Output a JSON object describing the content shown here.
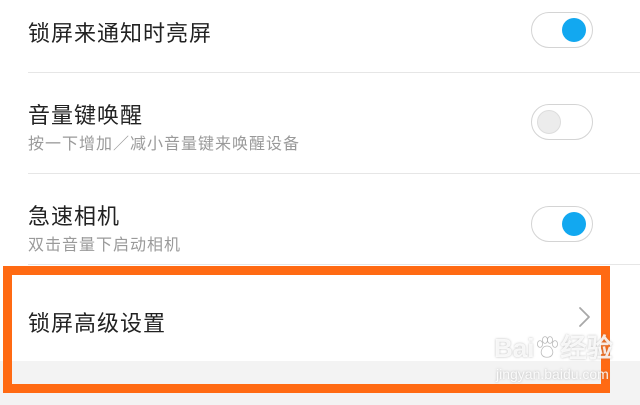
{
  "settings": {
    "items": [
      {
        "title": "锁屏来通知时亮屏",
        "subtitle": "",
        "toggle": "on"
      },
      {
        "title": "音量键唤醒",
        "subtitle": "按一下增加／减小音量键来唤醒设备",
        "toggle": "off"
      },
      {
        "title": "急速相机",
        "subtitle": "双击音量下启动相机",
        "toggle": "on"
      },
      {
        "title": "锁屏高级设置",
        "subtitle": "",
        "icon": "chevron-right-icon"
      }
    ]
  },
  "annotation": {
    "highlight_color": "#ff6a13"
  },
  "watermark": {
    "brand_left": "Bai",
    "brand_right": "经验",
    "url": "jingyan.baidu.com"
  },
  "colors": {
    "toggle_on": "#12a8f0",
    "toggle_off": "#ececec",
    "title_text": "#222222",
    "subtitle_text": "#9a9a9a"
  }
}
